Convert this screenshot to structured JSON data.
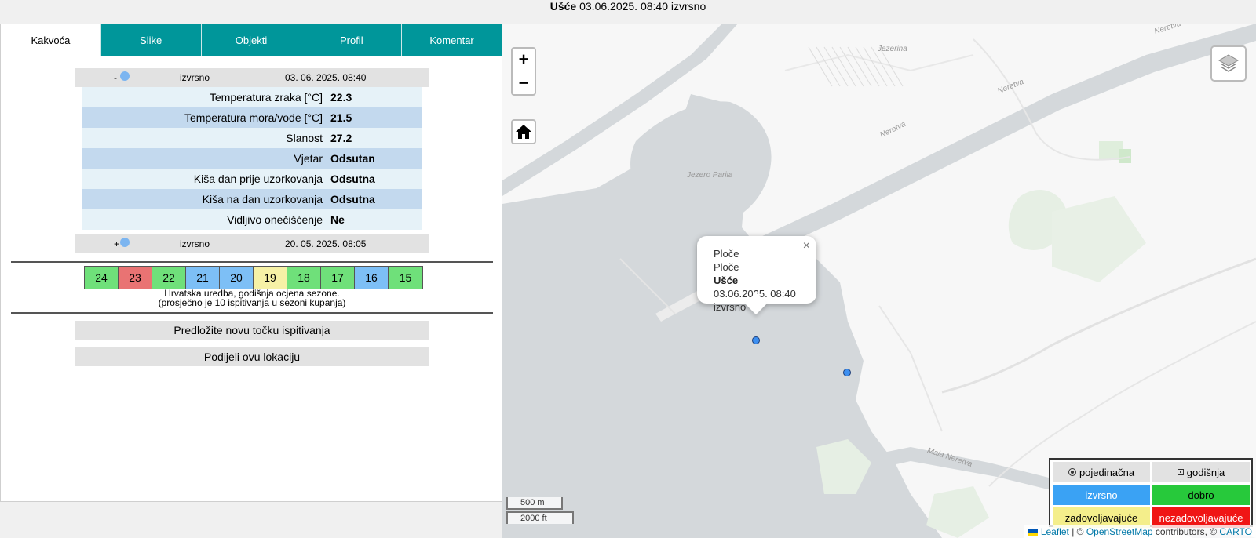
{
  "header": {
    "location": "Ušće",
    "datetime": "03.06.2025. 08:40",
    "status": "izvrsno"
  },
  "tabs": [
    {
      "label": "Kakvoća",
      "active": true
    },
    {
      "label": "Slike"
    },
    {
      "label": "Objekti"
    },
    {
      "label": "Profil"
    },
    {
      "label": "Komentar"
    }
  ],
  "measurements": [
    {
      "toggle": "-",
      "status": "izvrsno",
      "date": "03. 06. 2025. 08:40",
      "expanded": true
    },
    {
      "toggle": "+",
      "status": "izvrsno",
      "date": "20. 05. 2025. 08:05",
      "expanded": false
    }
  ],
  "parameters": [
    {
      "label": "Temperatura zraka [°C]",
      "value": "22.3"
    },
    {
      "label": "Temperatura mora/vode [°C]",
      "value": "21.5"
    },
    {
      "label": "Slanost",
      "value": "27.2"
    },
    {
      "label": "Vjetar",
      "value": "Odsutan"
    },
    {
      "label": "Kiša dan prije uzorkovanja",
      "value": "Odsutna"
    },
    {
      "label": "Kiša na dan uzorkovanja",
      "value": "Odsutna"
    },
    {
      "label": "Vidljivo onečišćenje",
      "value": "Ne"
    }
  ],
  "seasons": [
    {
      "year": "24",
      "color": "#6fe07a"
    },
    {
      "year": "23",
      "color": "#e97373"
    },
    {
      "year": "22",
      "color": "#6fe07a"
    },
    {
      "year": "21",
      "color": "#7dbff6"
    },
    {
      "year": "20",
      "color": "#7dbff6"
    },
    {
      "year": "19",
      "color": "#f6f1a6"
    },
    {
      "year": "18",
      "color": "#6fe07a"
    },
    {
      "year": "17",
      "color": "#6fe07a"
    },
    {
      "year": "16",
      "color": "#7dbff6"
    },
    {
      "year": "15",
      "color": "#6fe07a"
    }
  ],
  "season_note_line1": "Hrvatska uredba, godišnja ocjena sezone.",
  "season_note_line2": "(prosječno je 10 ispitivanja u sezoni kupanja)",
  "buttons": {
    "suggest": "Predložite novu točku ispitivanja",
    "share": "Podijeli ovu lokaciju"
  },
  "map": {
    "zoom_in": "+",
    "zoom_out": "−",
    "labels": {
      "jezerina": "Jezerina",
      "jezero_parila": "Jezero Parila",
      "neretva1": "Neretva",
      "neretva2": "Neretva",
      "neretva3": "Neretva",
      "mala_neretva": "Mala Neretva"
    },
    "popup": {
      "line1": "Ploče",
      "line2": "Ploče",
      "name": "Ušće",
      "datetime": "03.06.2025. 08:40",
      "status": "izvrsno",
      "close": "×"
    },
    "scale_metric": "500 m",
    "scale_imperial": "2000 ft",
    "legend": {
      "single": "pojedinačna",
      "annual": "godišnja",
      "excellent": "izvrsno",
      "good": "dobro",
      "sufficient": "zadovoljavajuće",
      "poor": "nezadovoljavajuće"
    },
    "attribution": {
      "leaflet": "Leaflet",
      "sep1": " | © ",
      "osm": "OpenStreetMap",
      "contrib": " contributors, © ",
      "carto": "CARTO"
    }
  }
}
